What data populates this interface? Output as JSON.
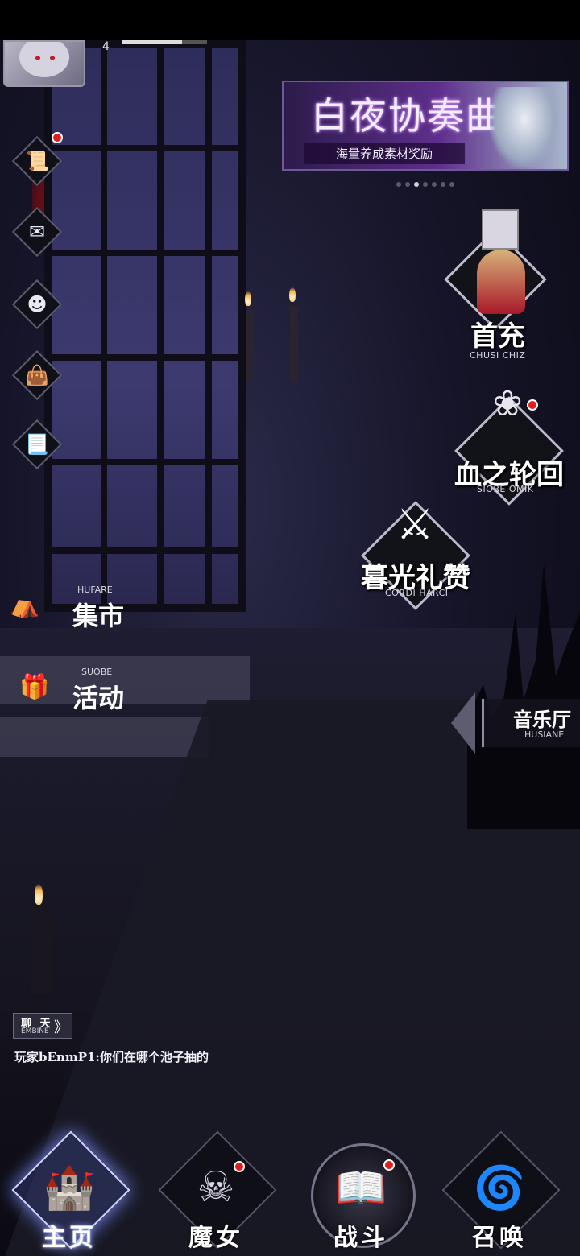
{
  "player": {
    "level": "4",
    "exp_fraction": 0.7
  },
  "banner": {
    "title": "白夜协奏曲",
    "subtitle": "海量养成素材奖励",
    "page_count": 7,
    "active_index": 2
  },
  "side_menu": [
    {
      "name": "quest-scroll",
      "icon": "📜",
      "badge": true
    },
    {
      "name": "mail",
      "icon": "✉",
      "badge": false
    },
    {
      "name": "friends",
      "icon": "☻",
      "badge": false
    },
    {
      "name": "bag",
      "icon": "👜",
      "badge": false
    },
    {
      "name": "notice",
      "icon": "📃",
      "badge": false
    }
  ],
  "features": {
    "first_charge": {
      "cn": "首充",
      "en": "CHUSI CHIZ"
    },
    "blood_cycle": {
      "cn": "血之轮回",
      "en": "SIOBE OMIK"
    },
    "twilight_hymn": {
      "cn": "暮光礼赞",
      "en": "CORDI HARCI"
    }
  },
  "menu": {
    "market": {
      "cn": "集市",
      "en": "HUFARE"
    },
    "events": {
      "cn": "活动",
      "en": "SUOBE"
    }
  },
  "music_hall": {
    "cn": "音乐厅",
    "en": "HUSIANE"
  },
  "chat": {
    "tab_cn": "聊 天",
    "tab_en": "EMBINE",
    "chevron": "》",
    "message": "玩家bEnmP1:你们在哪个池子抽的"
  },
  "nav": {
    "home": {
      "label": "主页",
      "icon": "🏰"
    },
    "witch": {
      "label": "魔女",
      "icon": "☠"
    },
    "battle": {
      "label": "战斗",
      "icon": "📖"
    },
    "summon": {
      "label": "召唤",
      "icon": "🌀"
    }
  },
  "colors": {
    "badge": "#e31c1c",
    "active_glow": "#7f90ff"
  }
}
